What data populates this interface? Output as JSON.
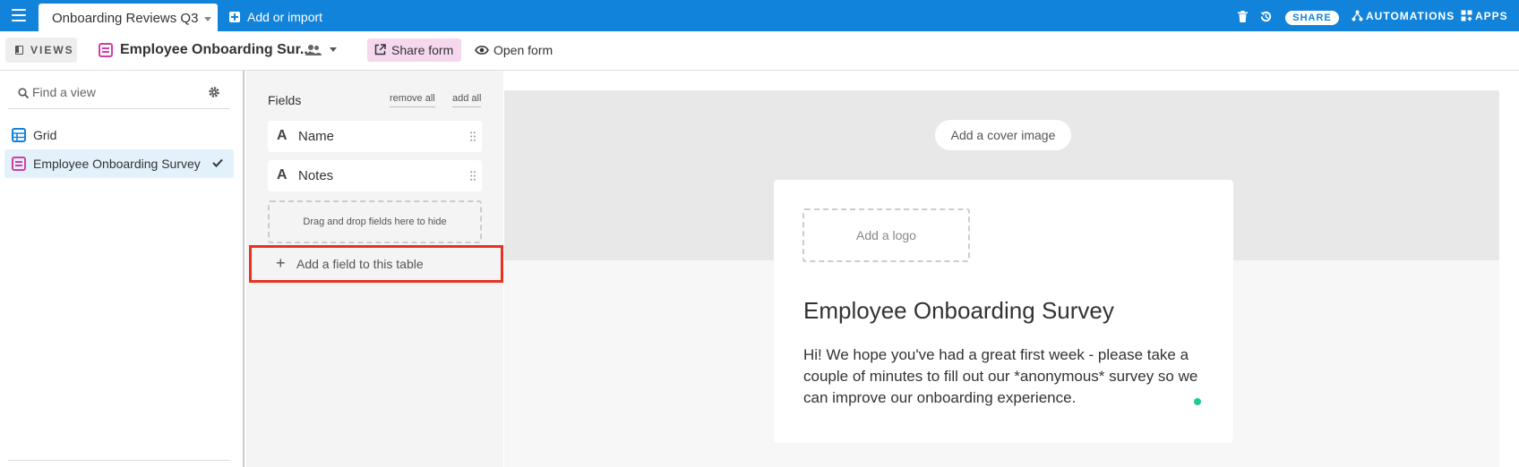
{
  "topbar": {
    "base_name": "Onboarding Reviews Q3",
    "add_import_label": "Add or import",
    "share_label": "SHARE",
    "automations_label": "AUTOMATIONS",
    "apps_label": "APPS",
    "accent_color": "#1283da"
  },
  "viewbar": {
    "views_label": "VIEWS",
    "current_view": "Employee Onboarding Sur...",
    "share_form_label": "Share form",
    "open_form_label": "Open form"
  },
  "sidebar": {
    "search_placeholder": "Find a view",
    "items": [
      {
        "label": "Grid",
        "icon": "grid-icon",
        "selected": false
      },
      {
        "label": "Employee Onboarding Survey",
        "icon": "form-icon",
        "selected": true
      }
    ]
  },
  "fields": {
    "title": "Fields",
    "remove_all": "remove all",
    "add_all": "add all",
    "items": [
      {
        "type_glyph": "A",
        "name": "Name"
      },
      {
        "type_glyph": "A",
        "name": "Notes"
      }
    ],
    "drop_hint": "Drag and drop fields here to hide",
    "add_field_label": "Add a field to this table"
  },
  "form": {
    "cover_label": "Add a cover image",
    "logo_label": "Add a logo",
    "title": "Employee Onboarding Survey",
    "description": "Hi! We hope you've had a great first week - please take a couple of minutes to fill out our *anonymous* survey so we can improve our onboarding experience."
  }
}
